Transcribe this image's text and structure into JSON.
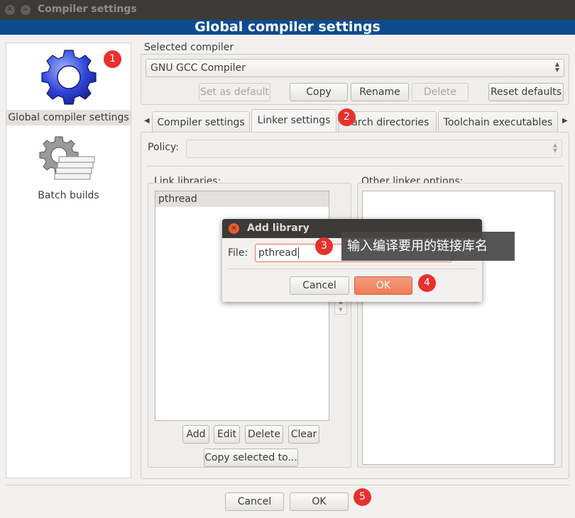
{
  "window": {
    "title": "Compiler settings"
  },
  "banner": {
    "title": "Global compiler settings"
  },
  "sidebar": {
    "items": [
      {
        "label": "Global compiler settings",
        "icon": "gear-icon"
      },
      {
        "label": "Batch builds",
        "icon": "gear-stack-icon"
      }
    ]
  },
  "compiler": {
    "selected_label": "Selected compiler",
    "selected_value": "GNU GCC Compiler",
    "buttons": {
      "set_default": "Set as default",
      "copy": "Copy",
      "rename": "Rename",
      "delete": "Delete",
      "reset": "Reset defaults"
    }
  },
  "tabs": [
    {
      "label": "Compiler settings"
    },
    {
      "label": "Linker settings"
    },
    {
      "label": "earch directories"
    },
    {
      "label": "Toolchain executables"
    }
  ],
  "linker": {
    "policy_label": "Policy:",
    "policy_value": "",
    "link_libraries_label": "Link libraries:",
    "libraries": [
      "pthread"
    ],
    "other_options_label": "Other linker options:",
    "list_buttons": {
      "add": "Add",
      "edit": "Edit",
      "delete": "Delete",
      "clear": "Clear"
    },
    "copy_selected": "Copy selected to..."
  },
  "dialog": {
    "title": "Add library",
    "file_label": "File:",
    "file_value": "pthread",
    "cancel": "Cancel",
    "ok": "OK"
  },
  "tooltip": {
    "text": "输入编译要用的链接库名"
  },
  "footer": {
    "cancel": "Cancel",
    "ok": "OK"
  },
  "badges": [
    "1",
    "2",
    "3",
    "4",
    "5"
  ],
  "colors": {
    "banner": "#0f4c8f",
    "badge": "#e8312c",
    "ok_accent": "#ef7d56"
  }
}
